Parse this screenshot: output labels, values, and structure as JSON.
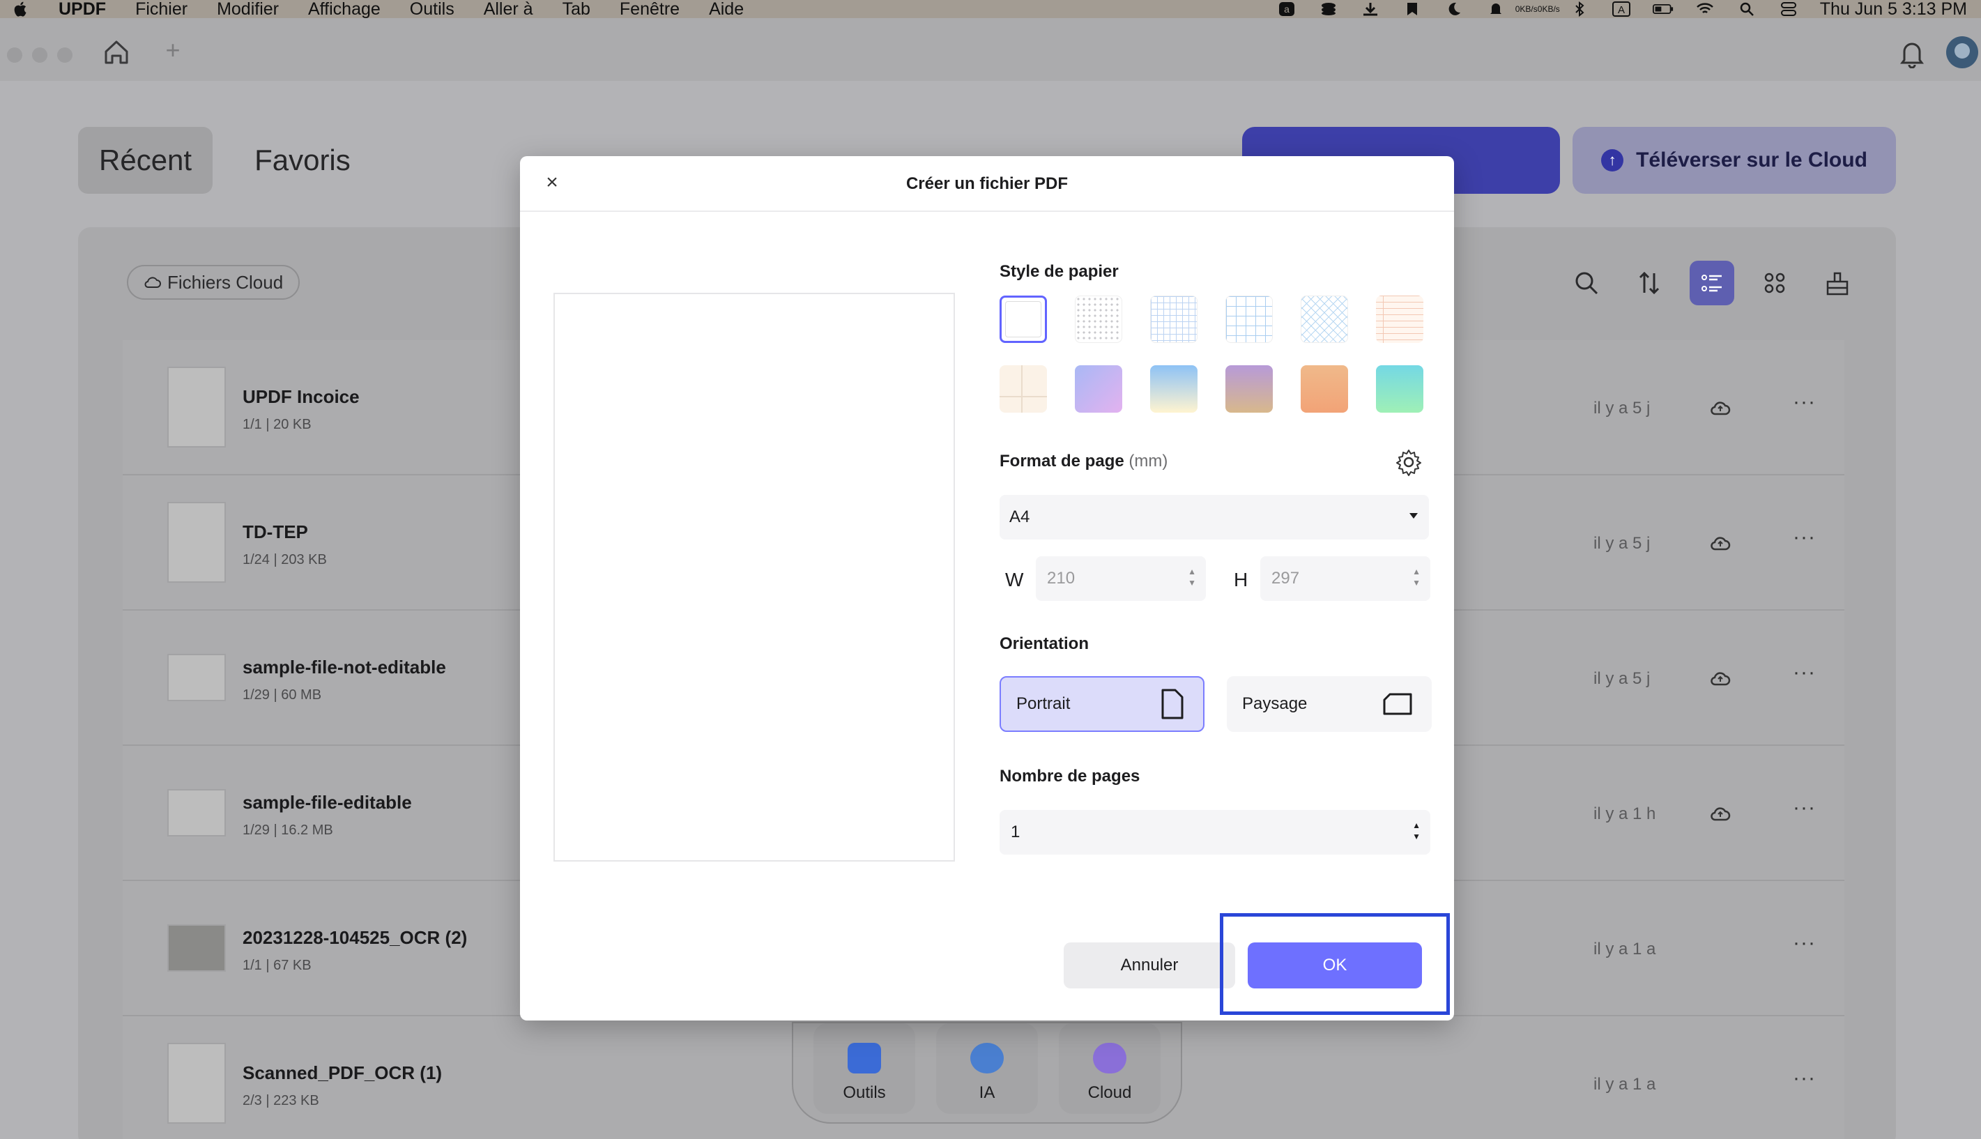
{
  "menubar": {
    "app": "UPDF",
    "items": [
      "Fichier",
      "Modifier",
      "Affichage",
      "Outils",
      "Aller à",
      "Tab",
      "Fenêtre",
      "Aide"
    ],
    "net_up": "0KB/s",
    "net_down": "0KB/s",
    "clock": "Thu Jun 5  3:13 PM",
    "input_source": "A"
  },
  "tabs": {
    "recent": "Récent",
    "favorites": "Favoris"
  },
  "header_buttons": {
    "cloud_upload": "Téléverser sur le Cloud"
  },
  "filter": {
    "cloud_files": "Fichiers Cloud"
  },
  "files": [
    {
      "name": "UPDF Incoice",
      "pages": "1/1",
      "size": "20 KB",
      "when": "il y a 5 j",
      "cloud": true
    },
    {
      "name": "TD-TEP",
      "pages": "1/24",
      "size": "203 KB",
      "when": "il y a 5 j",
      "cloud": true
    },
    {
      "name": "sample-file-not-editable",
      "pages": "1/29",
      "size": "60 MB",
      "when": "il y a 5 j",
      "cloud": true
    },
    {
      "name": "sample-file-editable",
      "pages": "1/29",
      "size": "16.2 MB",
      "when": "il y a 1 h",
      "cloud": true
    },
    {
      "name": "20231228-104525_OCR (2)",
      "pages": "1/1",
      "size": "67 KB",
      "when": "il y a 1 a",
      "cloud": false
    },
    {
      "name": "Scanned_PDF_OCR (1)",
      "pages": "2/3",
      "size": "223 KB",
      "when": "il y a 1 a",
      "cloud": false
    }
  ],
  "dock": {
    "tools": "Outils",
    "ai": "IA",
    "cloud": "Cloud"
  },
  "modal": {
    "title": "Créer un fichier PDF",
    "paper_style_label": "Style de papier",
    "page_format_label": "Format de page",
    "page_format_unit": "(mm)",
    "page_format_value": "A4",
    "width_label": "W",
    "width_value": "210",
    "height_label": "H",
    "height_value": "297",
    "orientation_label": "Orientation",
    "portrait": "Portrait",
    "landscape": "Paysage",
    "selected_orientation": "Portrait",
    "page_count_label": "Nombre de pages",
    "page_count_value": "1",
    "cancel": "Annuler",
    "ok": "OK"
  },
  "colors": {
    "accent": "#6E70FF",
    "highlight_box": "#2A46D8",
    "selected_tab_bg": "#5E5FB0"
  }
}
